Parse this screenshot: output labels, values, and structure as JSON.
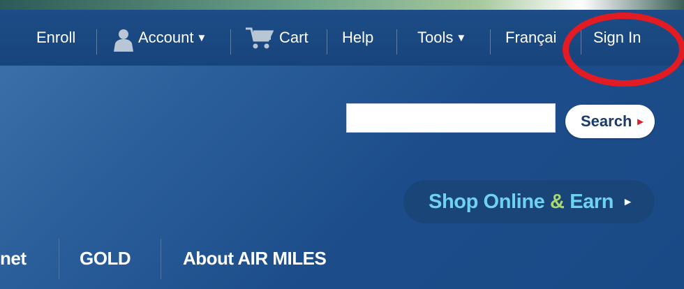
{
  "top_nav": {
    "enroll": "Enroll",
    "account": "Account",
    "cart": "Cart",
    "help": "Help",
    "tools": "Tools",
    "francais": "Françai",
    "sign_in": "Sign In"
  },
  "icons": {
    "account": "person-silhouette-icon",
    "cart": "shopping-cart-icon",
    "dropdown": "caret-down-icon"
  },
  "search": {
    "value": "",
    "button_label": "Search",
    "arrow": "▸"
  },
  "shop": {
    "label_part1": "Shop Online ",
    "label_amp": "&",
    "label_part2": " Earn",
    "arrow": "▸"
  },
  "bottom_nav": {
    "item_partial": "net",
    "gold": "GOLD",
    "about": "About AIR MILES"
  },
  "colors": {
    "nav_bar": "#1d4c86",
    "page_bg": "#2a5e9a",
    "shop_text": "#6fd2f0",
    "shop_amp": "#a9d86e",
    "search_arrow": "#d8242a",
    "annotation_circle": "#e31b23"
  }
}
